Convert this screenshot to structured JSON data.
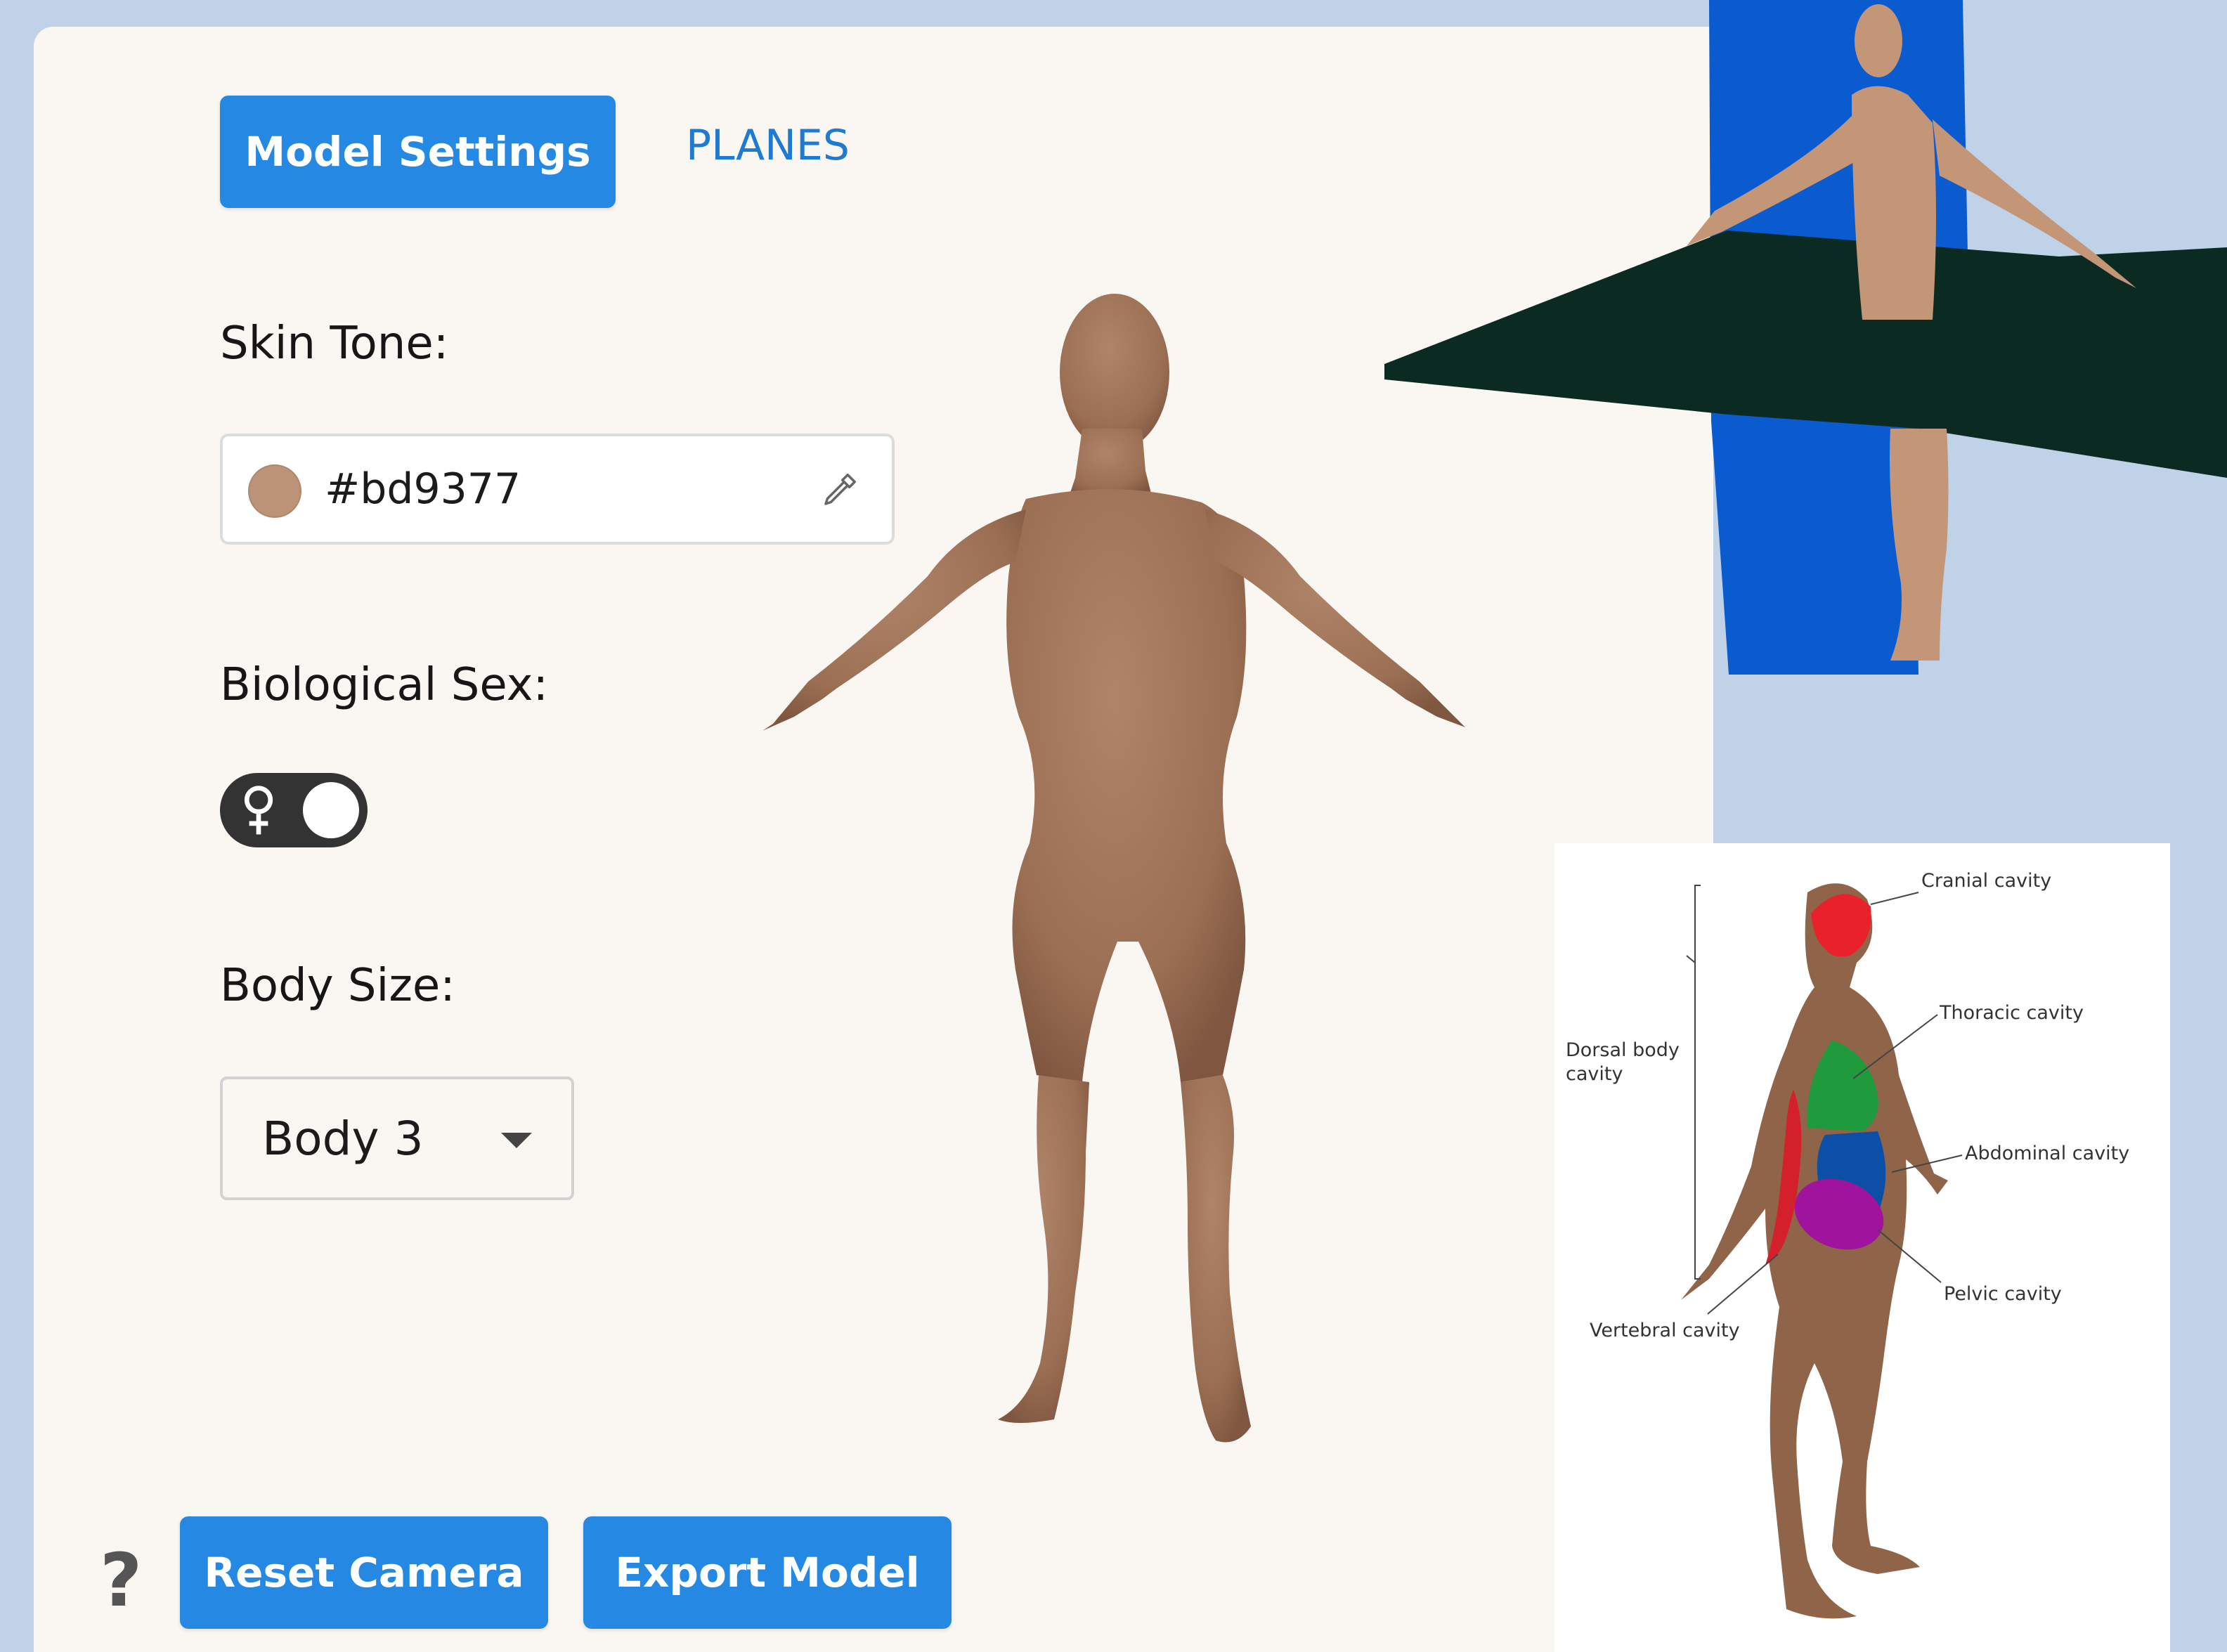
{
  "tabs": [
    {
      "label": "Model Settings",
      "active": true
    },
    {
      "label": "PLANES",
      "active": false
    }
  ],
  "skin_tone": {
    "label": "Skin Tone:",
    "value": "#bd9377",
    "swatch_color": "#bd9377",
    "picker_icon": "eyedropper-icon"
  },
  "biological_sex": {
    "label": "Biological Sex:",
    "toggle_icon": "female-symbol-icon",
    "toggle_state": "female"
  },
  "body_size": {
    "label": "Body Size:",
    "selected": "Body 3"
  },
  "footer": {
    "help_symbol": "?",
    "reset_label": "Reset Camera",
    "export_label": "Export Model"
  },
  "cavity_diagram": {
    "labels": {
      "cranial": "Cranial cavity",
      "thoracic": "Thoracic cavity",
      "dorsal": "Dorsal body cavity",
      "abdominal": "Abdominal cavity",
      "pelvic": "Pelvic cavity",
      "vertebral": "Vertebral cavity"
    },
    "colors": {
      "cranial": "#e8212a",
      "thoracic": "#1f9a3c",
      "abdominal": "#0c4fa6",
      "pelvic": "#a0139d",
      "vertebral": "#d4202a"
    }
  },
  "colors": {
    "accent": "#2589e3",
    "skin": "#bd9377",
    "sagittal_plane": "#0a5bd0",
    "transverse_plane": "#0b2a22"
  }
}
